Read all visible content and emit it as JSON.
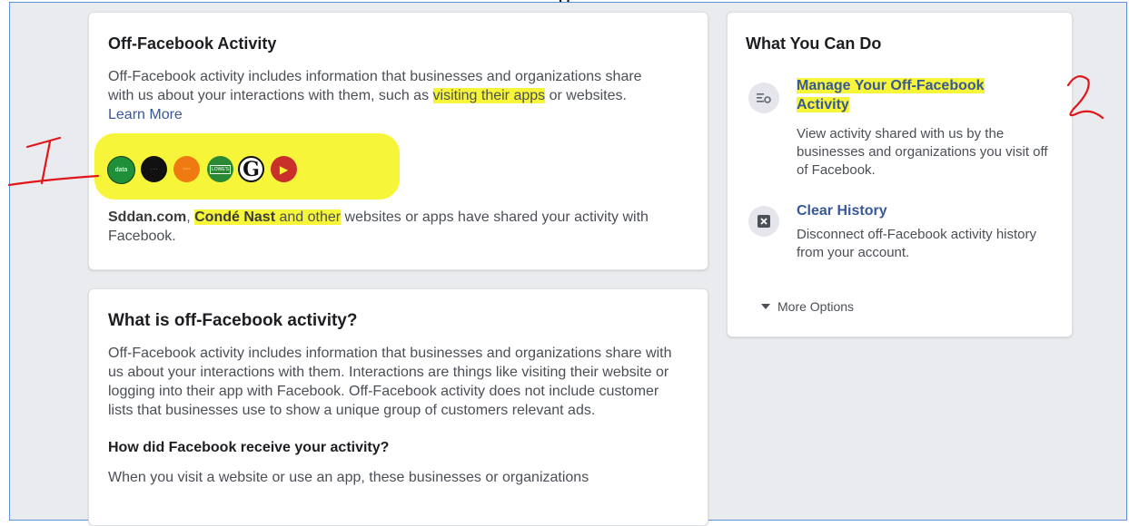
{
  "top_caption": "g",
  "off_card": {
    "title": "Off-Facebook Activity",
    "description_a": "Off-Facebook activity includes information that businesses and organizations share with us about your interactions with them, such as ",
    "description_hl": "visiting their apps",
    "description_b": " or websites. ",
    "learn_more": "Learn More",
    "apps": [
      {
        "name": "data-app-icon",
        "color": "#1f8f3a",
        "label": "data"
      },
      {
        "name": "black-app-icon",
        "color": "#111111",
        "label": ""
      },
      {
        "name": "orange-app-icon",
        "color": "#f07a12",
        "label": ""
      },
      {
        "name": "green-app-icon",
        "color": "#2a8a34",
        "label": "LOWE'S"
      },
      {
        "name": "g-app-icon",
        "color": "#ffffff",
        "label": "G"
      },
      {
        "name": "play-app-icon",
        "color": "#c9302c",
        "label": "▶"
      }
    ],
    "shared_site1": "Sddan.com",
    "shared_sep": ", ",
    "shared_site2_hl": "Condé Nast",
    "shared_mid_hl": " and other",
    "shared_rest": " websites or apps have shared your activity with Facebook."
  },
  "what_card": {
    "title": "What is off-Facebook activity?",
    "description": "Off-Facebook activity includes information that businesses and organizations share with us about your interactions with them. Interactions are things like visiting their website or logging into their app with Facebook. Off-Facebook activity does not include customer lists that businesses use to show a unique group of customers relevant ads.",
    "subheading": "How did Facebook receive your activity?",
    "partial_text": "When you visit a website or use an app, these businesses or organizations"
  },
  "todo_card": {
    "title": "What You Can Do",
    "manage_title": "Manage Your Off-Facebook Activity",
    "manage_desc": "View activity shared with us by the businesses and organizations you visit off of Facebook.",
    "clear_title": "Clear History",
    "clear_desc": "Disconnect off-Facebook activity history from your account.",
    "more_options": "More Options"
  },
  "colors": {
    "highlight": "#f7f53a",
    "annotation": "#e0161a",
    "link": "#385898"
  }
}
